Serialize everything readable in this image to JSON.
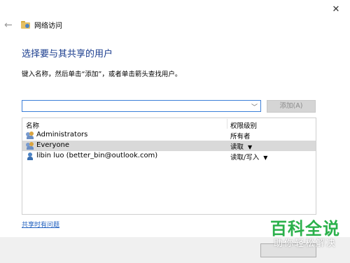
{
  "window": {
    "title": "网络访问",
    "close_glyph": "✕",
    "back_glyph": "←"
  },
  "main": {
    "heading": "选择要与其共享的用户",
    "instruction": "键入名称，然后单击“添加”，或者单击箭头查找用户。",
    "combo_value": "",
    "add_button_label": "添加(A)",
    "share_help_link": "共享时有问题"
  },
  "list": {
    "headers": {
      "name": "名称",
      "permission": "权限级别"
    },
    "rows": [
      {
        "name": "Administrators",
        "permission": "所有者",
        "icon": "group-icon",
        "selected": false,
        "has_dropdown": false
      },
      {
        "name": "Everyone",
        "permission": "读取",
        "icon": "group-icon",
        "selected": true,
        "has_dropdown": true
      },
      {
        "name": "libin luo (better_bin@outlook.com)",
        "permission": "读取/写入",
        "icon": "user-icon",
        "selected": false,
        "has_dropdown": true
      }
    ]
  },
  "watermark": {
    "main": "百科全说",
    "sub": "助你轻松解决"
  },
  "colors": {
    "heading": "#1a3c8e",
    "link": "#1f5fbf",
    "combo_border": "#3c7fd8",
    "selected_row": "#d9d9d9",
    "watermark_green": "#2bb14b"
  }
}
